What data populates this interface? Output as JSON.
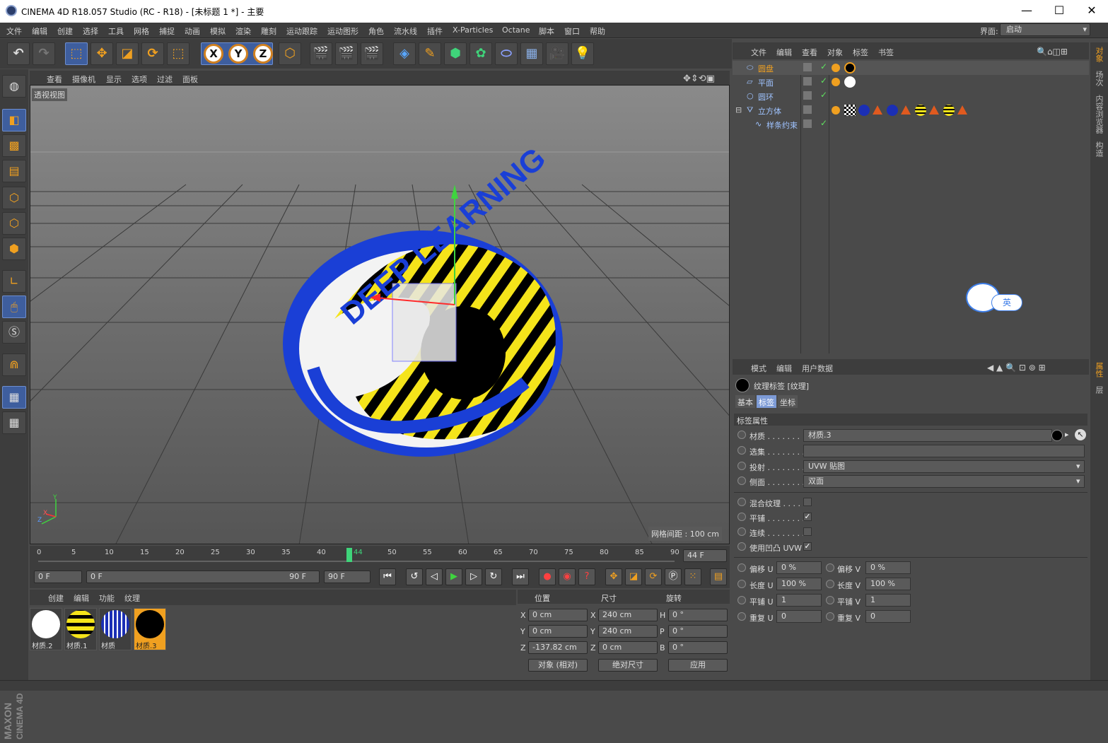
{
  "window": {
    "title": "CINEMA 4D R18.057 Studio (RC - R18) - [未标题 1 *] - 主要",
    "min": "—",
    "max": "☐",
    "close": "✕"
  },
  "menu": [
    "文件",
    "编辑",
    "创建",
    "选择",
    "工具",
    "网格",
    "捕捉",
    "动画",
    "模拟",
    "渲染",
    "雕刻",
    "运动跟踪",
    "运动图形",
    "角色",
    "流水线",
    "插件",
    "X-Particles",
    "Octane",
    "脚本",
    "窗口",
    "帮助"
  ],
  "interface": {
    "label": "界面:",
    "value": "启动"
  },
  "viewport": {
    "menu": [
      "查看",
      "摄像机",
      "显示",
      "选项",
      "过滤",
      "面板"
    ],
    "view_label": "透视视图",
    "grid_spacing": "网格间距 : 100 cm",
    "axis_y": "Y",
    "axis_z": "Z",
    "axis_x": "X"
  },
  "timeline": {
    "ticks": [
      "0",
      "5",
      "10",
      "15",
      "20",
      "25",
      "30",
      "35",
      "40",
      "45",
      "50",
      "55",
      "60",
      "65",
      "70",
      "75",
      "80",
      "85",
      "90"
    ],
    "current": "44",
    "end_field": "44 F"
  },
  "playback": {
    "start": "0 F",
    "range_start": "0 F",
    "range_end": "90 F",
    "end": "90 F"
  },
  "materials": {
    "menu": [
      "创建",
      "编辑",
      "功能",
      "纹理"
    ],
    "items": [
      {
        "name": "材质.2",
        "color": "#ffffff"
      },
      {
        "name": "材质.1",
        "color": "#f5e41a"
      },
      {
        "name": "材质",
        "color": "#1b2fb5"
      },
      {
        "name": "材质.3",
        "color": "#000000"
      }
    ]
  },
  "coords": {
    "headers": [
      "位置",
      "尺寸",
      "旋转"
    ],
    "rows": [
      {
        "axis": "X",
        "pos": "0 cm",
        "sizeaxis": "X",
        "size": "240 cm",
        "rotaxis": "H",
        "rot": "0 °"
      },
      {
        "axis": "Y",
        "pos": "0 cm",
        "sizeaxis": "Y",
        "size": "240 cm",
        "rotaxis": "P",
        "rot": "0 °"
      },
      {
        "axis": "Z",
        "pos": "-137.82 cm",
        "sizeaxis": "Z",
        "size": "0 cm",
        "rotaxis": "B",
        "rot": "0 °"
      }
    ],
    "mode": "对象 (相对)",
    "size_mode": "绝对尺寸",
    "apply": "应用"
  },
  "objects": {
    "menu": [
      "文件",
      "编辑",
      "查看",
      "对象",
      "标签",
      "书签"
    ],
    "items": [
      {
        "name": "圆盘"
      },
      {
        "name": "平面"
      },
      {
        "name": "圆环"
      },
      {
        "name": "立方体"
      },
      {
        "name": "样条约束"
      }
    ]
  },
  "side_tabs": [
    "对象",
    "场次",
    "内容浏览器",
    "构造",
    "属性",
    "层"
  ],
  "attributes": {
    "menu": [
      "模式",
      "编辑",
      "用户数据"
    ],
    "title": "纹理标签 [纹理]",
    "tabs": [
      "基本",
      "标签",
      "坐标"
    ],
    "section": "标签属性",
    "fields": [
      {
        "label": "材质 . . . . . . .",
        "value": "材质.3"
      },
      {
        "label": "选集 . . . . . . . .",
        "value": ""
      },
      {
        "label": "投射 . . . . . . . .",
        "value": "UVW 贴图"
      },
      {
        "label": "侧面 . . . . . . . .",
        "value": "双面"
      }
    ],
    "checks": [
      {
        "label": "混合纹理 . . . . .",
        "checked": ""
      },
      {
        "label": "平铺 . . . . . . . .",
        "checked": "✓"
      },
      {
        "label": "连续 . . . . . . . .",
        "checked": ""
      },
      {
        "label": "使用凹凸 UVW",
        "checked": "✓"
      }
    ],
    "uv": [
      {
        "l1": "偏移 U",
        "v1": "0 %",
        "l2": "偏移 V",
        "v2": "0 %"
      },
      {
        "l1": "长度 U",
        "v1": "100 %",
        "l2": "长度 V",
        "v2": "100 %"
      },
      {
        "l1": "平铺 U",
        "v1": "1",
        "l2": "平铺 V",
        "v2": "1"
      },
      {
        "l1": "重复 U",
        "v1": "0",
        "l2": "重复 V",
        "v2": "0"
      }
    ]
  },
  "ime": {
    "label": "英"
  },
  "colors": {
    "accent": "#f0a020",
    "selection": "#3e5e9e",
    "text_blue": "#9fc3ff"
  }
}
